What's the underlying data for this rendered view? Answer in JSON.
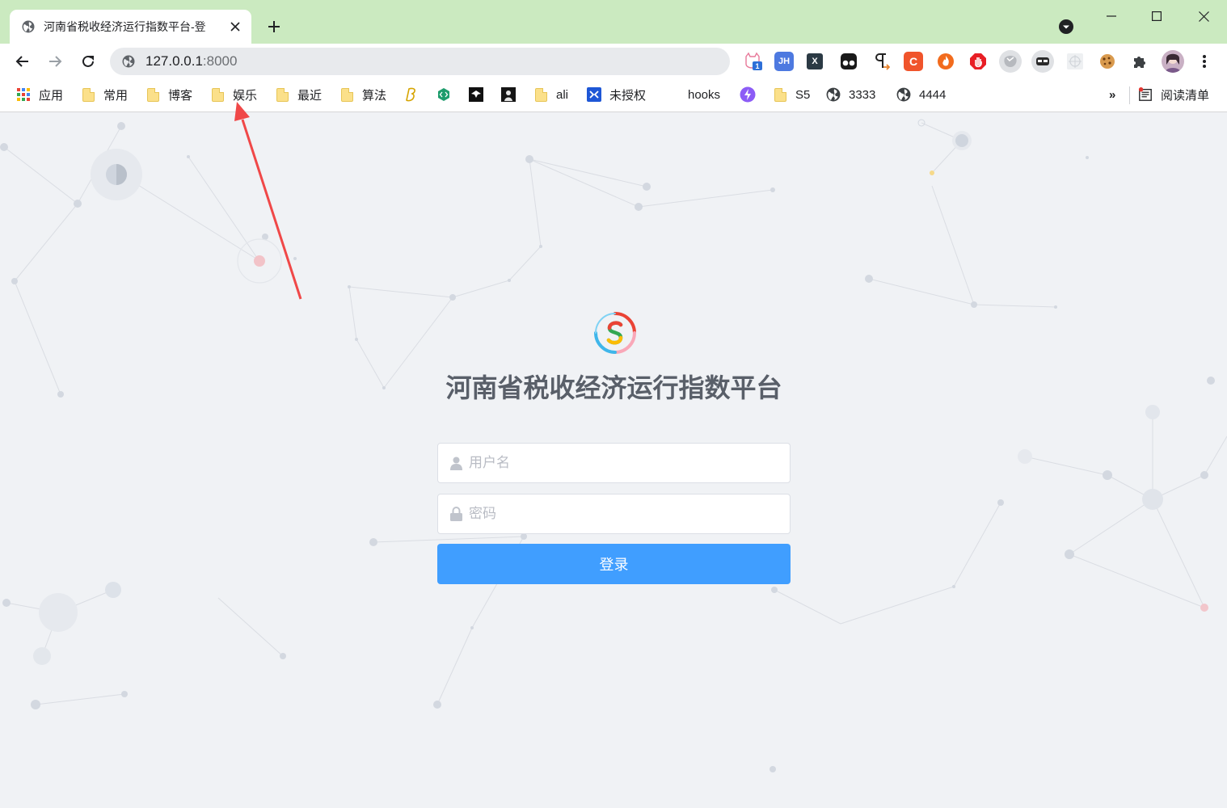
{
  "browser": {
    "tab": {
      "title": "河南省税收经济运行指数平台-登",
      "close_icon": "close-icon",
      "favicon": "globe-icon"
    },
    "address": {
      "host": "127.0.0.1",
      "port": ":8000"
    },
    "extensions": [
      {
        "name": "cat-extension-icon",
        "badge": "1"
      },
      {
        "name": "jh-extension-icon",
        "text": "JH"
      },
      {
        "name": "x-extension-icon",
        "text": "X"
      },
      {
        "name": "tampermonkey-icon"
      },
      {
        "name": "pilcrow-extension-icon"
      },
      {
        "name": "c-extension-icon",
        "text": "C"
      },
      {
        "name": "fire-extension-icon"
      },
      {
        "name": "adblock-icon"
      },
      {
        "name": "white-circle-extension-icon"
      },
      {
        "name": "mask-extension-icon"
      },
      {
        "name": "grid-extension-icon"
      },
      {
        "name": "cookie-icon"
      },
      {
        "name": "puzzle-icon"
      },
      {
        "name": "profile-avatar"
      },
      {
        "name": "menu-icon"
      }
    ],
    "bookmarks": {
      "apps": "应用",
      "items": [
        "常用",
        "博客",
        "娱乐",
        "最近",
        "算法",
        "ali",
        "未授权",
        "hooks",
        "S5",
        "3333",
        "4444"
      ],
      "more": "»",
      "reading_list": "阅读清单"
    }
  },
  "login": {
    "title": "河南省税收经济运行指数平台",
    "username_placeholder": "用户名",
    "password_placeholder": "密码",
    "submit_label": "登录"
  },
  "colors": {
    "titlebar": "#cbeac0",
    "primary": "#409eff",
    "page_bg": "#f0f2f5",
    "annotation_arrow": "#f04848"
  }
}
